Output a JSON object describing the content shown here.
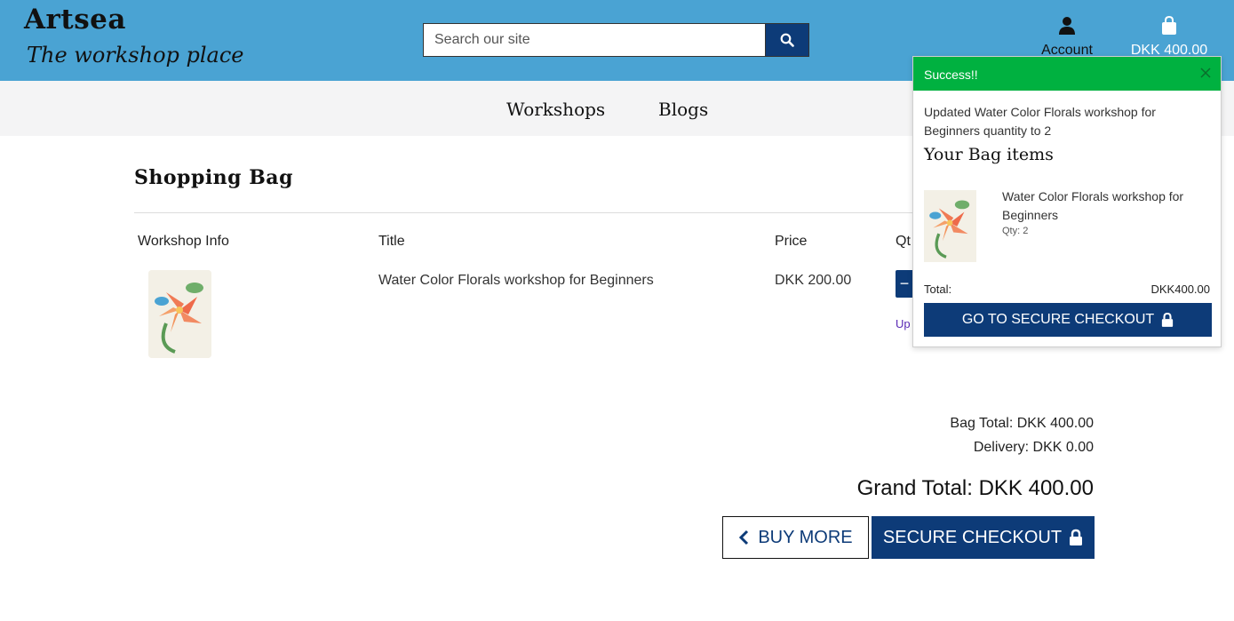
{
  "header": {
    "brand": "Artsea",
    "tagline": "The workshop place",
    "search_placeholder": "Search our site",
    "account_label": "Account",
    "bag_total": "DKK 400.00"
  },
  "subnav": {
    "items": [
      "Workshops",
      "Blogs"
    ]
  },
  "main": {
    "title": "Shopping Bag",
    "columns": [
      "Workshop Info",
      "Title",
      "Price",
      "Qt"
    ],
    "rows": [
      {
        "title": "Water Color Florals workshop for Beginners",
        "price": "DKK 200.00",
        "qty_minus": "−",
        "update_label": "Up"
      }
    ],
    "bag_total": "Bag Total: DKK 400.00",
    "delivery": "Delivery: DKK 0.00",
    "grand_total": "Grand Total: DKK 400.00",
    "buy_more": "BUY MORE",
    "secure_checkout": "SECURE CHECKOUT"
  },
  "toast": {
    "title": "Success!!",
    "message": "Updated Water Color Florals workshop for Beginners quantity to 2",
    "subtitle": "Your Bag items",
    "item_title": "Water Color Florals workshop for Beginners",
    "item_qty": "Qty: 2",
    "total_label": "Total:",
    "total_value": "DKK400.00",
    "checkout": "GO TO SECURE CHECKOUT"
  },
  "colors": {
    "header": "#4aa3d3",
    "primary": "#0d3b78",
    "success": "#00b140"
  },
  "icons": [
    "search-icon",
    "user-icon",
    "shopping-bag-icon",
    "close-icon",
    "lock-icon",
    "chevron-left-icon"
  ]
}
